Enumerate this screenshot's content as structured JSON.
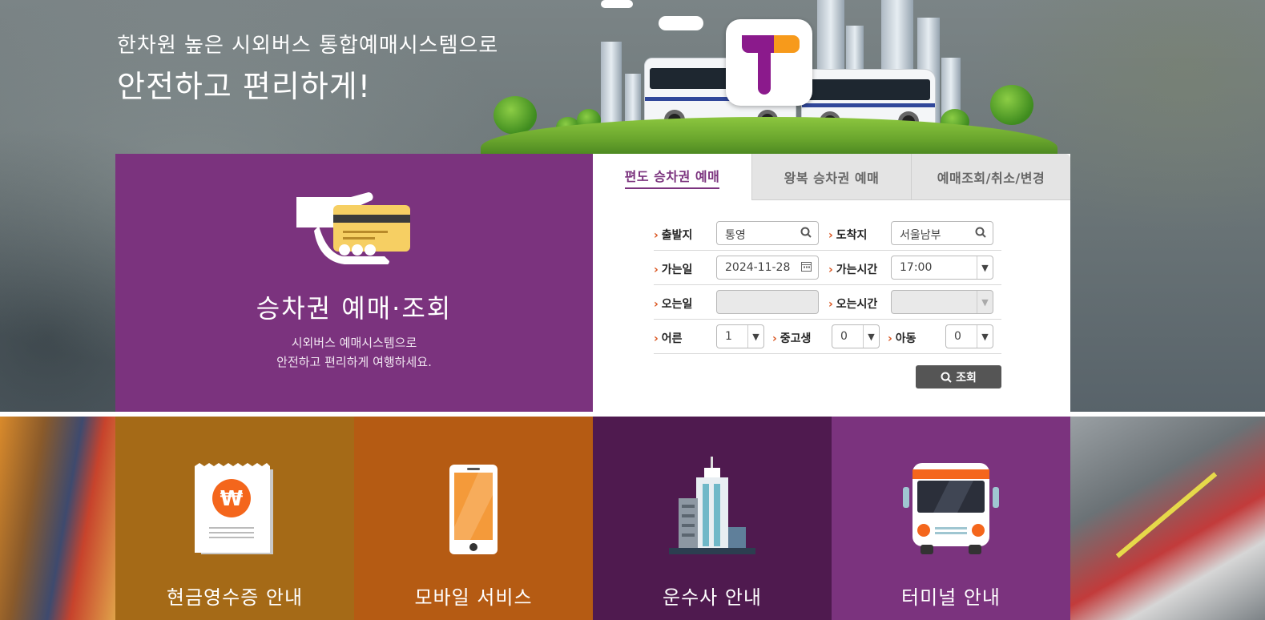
{
  "hero": {
    "slogan_line1": "한차원 높은 시외버스 통합예매시스템으로",
    "slogan_line2": "안전하고 편리하게!"
  },
  "left_panel": {
    "title": "승차권 예매·조회",
    "desc_line1": "시외버스 예매시스템으로",
    "desc_line2": "안전하고 편리하게 여행하세요."
  },
  "tabs": [
    {
      "label": "편도 승차권 예매",
      "active": true
    },
    {
      "label": "왕복 승차권 예매",
      "active": false
    },
    {
      "label": "예매조회/취소/변경",
      "active": false
    }
  ],
  "form": {
    "departure_label": "출발지",
    "departure_value": "통영",
    "arrival_label": "도착지",
    "arrival_value": "서울남부",
    "go_date_label": "가는일",
    "go_date_value": "2024-11-28",
    "go_time_label": "가는시간",
    "go_time_value": "17:00",
    "return_date_label": "오는일",
    "return_date_value": "",
    "return_time_label": "오는시간",
    "return_time_value": "",
    "adult_label": "어른",
    "adult_value": "1",
    "youth_label": "중고생",
    "youth_value": "0",
    "child_label": "아동",
    "child_value": "0",
    "search_button": "조회"
  },
  "tiles": [
    {
      "label": "현금영수증 안내",
      "color": "#a56a17",
      "icon": "receipt-icon"
    },
    {
      "label": "모바일 서비스",
      "color": "#b55b13",
      "icon": "mobile-phone-icon"
    },
    {
      "label": "운수사 안내",
      "color": "#4f1a4f",
      "icon": "building-icon"
    },
    {
      "label": "터미널 안내",
      "color": "#7b337e",
      "icon": "bus-icon"
    }
  ],
  "colors": {
    "purple": "#7b337e",
    "accent_orange": "#f4661c",
    "button_gray": "#555555"
  }
}
